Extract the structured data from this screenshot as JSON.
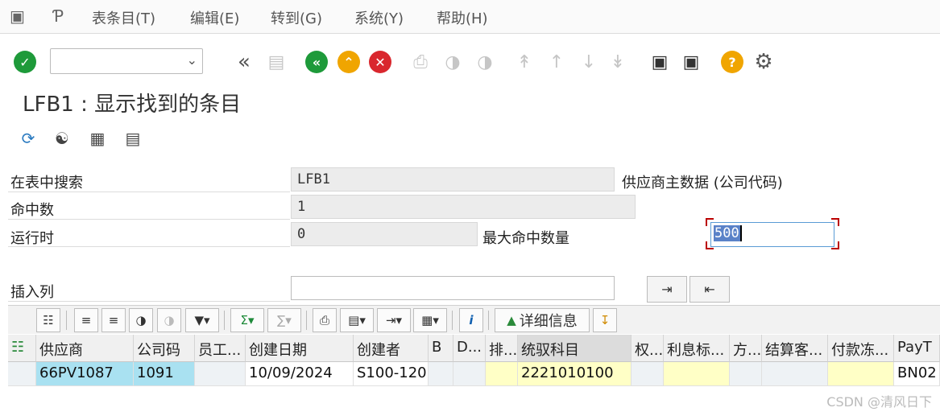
{
  "menu": [
    "表条目(T)",
    "编辑(E)",
    "转到(G)",
    "系统(Y)",
    "帮助(H)"
  ],
  "icons": {
    "menu_exit": "exit-icon",
    "menu_logo": "p-logo-icon",
    "enter": "enter-check-icon",
    "back": "back-icon",
    "exit": "exit-icon",
    "cancel": "cancel-icon",
    "help": "help-icon",
    "customize": "gear-icon"
  },
  "colors": {
    "enter": "#1e9a3a",
    "back": "#1e9a3a",
    "exit": "#f0a500",
    "cancel": "#d9272e",
    "help": "#f0a500",
    "key_cell": "#a9e1f1",
    "highlight_cell": "#ffffc6"
  },
  "title": "LFB1 : 显示找到的条目",
  "selection": {
    "search_in_table_label": "在表中搜索",
    "search_in_table_value": "LFB1",
    "table_description": "供应商主数据 (公司代码)",
    "hits_label": "命中数",
    "hits_value": "1",
    "runtime_label": "运行时",
    "runtime_value": "0",
    "max_hits_label": "最大命中数量",
    "max_hits_value": "500",
    "insert_col_label": "插入列"
  },
  "alv": {
    "details_label": "详细信息"
  },
  "columns": [
    "供应商",
    "公司码",
    "员工...",
    "创建日期",
    "创建者",
    "B",
    "D...",
    "排...",
    "统驭科目",
    "权...",
    "利息标...",
    "方...",
    "结算客...",
    "付款冻...",
    "PayT"
  ],
  "rows": [
    [
      "66PV1087",
      "1091",
      "",
      "10/09/2024",
      "S100-120",
      "",
      "",
      "",
      "2221010100",
      "",
      "",
      "",
      "",
      "",
      "BN02"
    ]
  ],
  "watermark": "CSDN @清风日下"
}
